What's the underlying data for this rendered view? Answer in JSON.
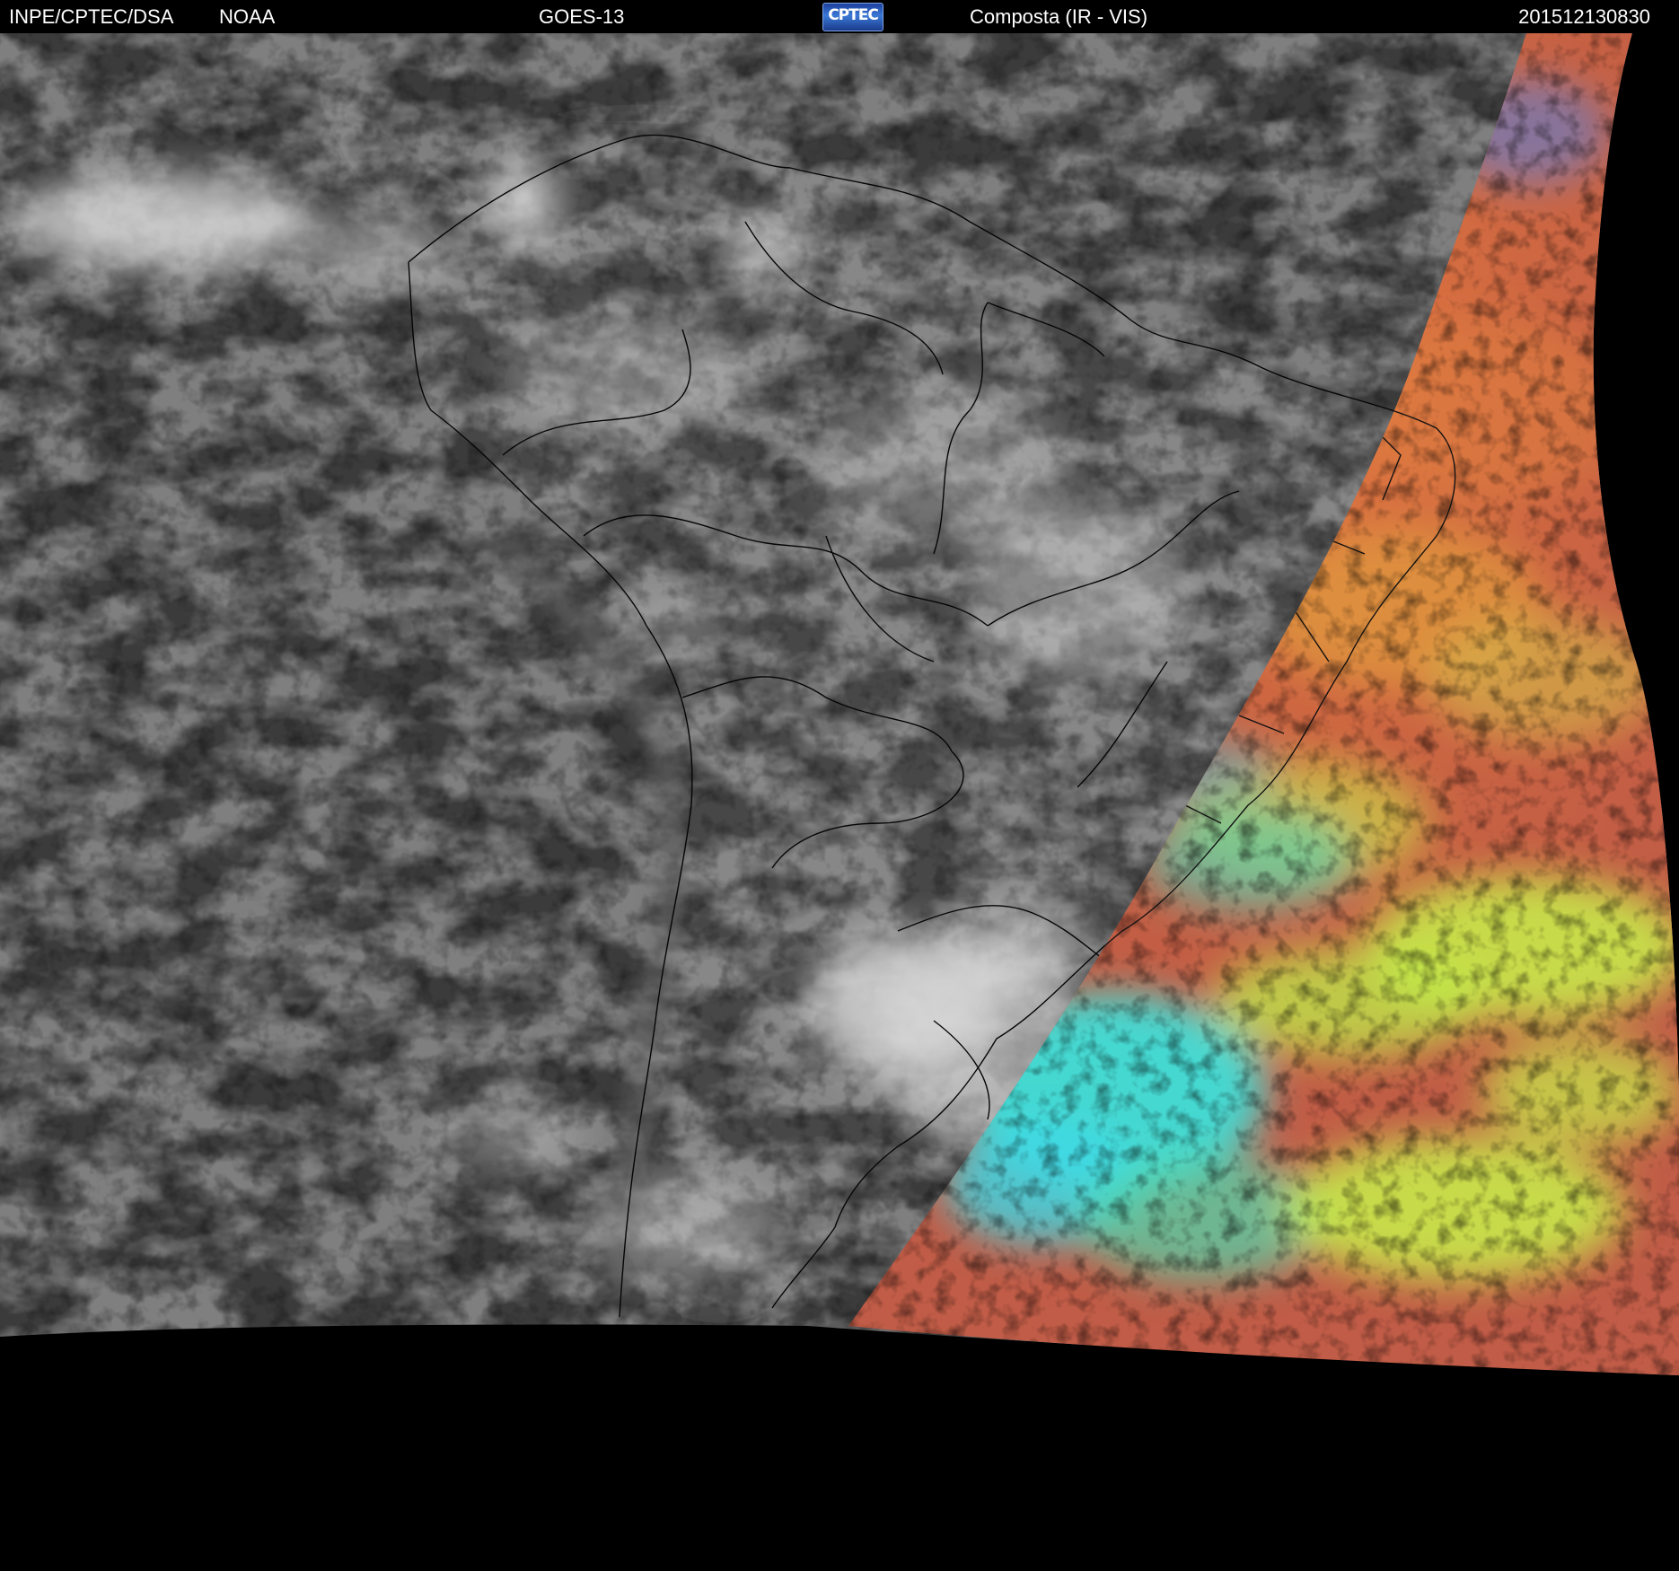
{
  "header": {
    "organization": "INPE/CPTEC/DSA",
    "agency": "NOAA",
    "satellite": "GOES-13",
    "logo_text": "CPTEC",
    "product": "Composta (IR - VIS)",
    "timestamp": "201512130830"
  },
  "imagery": {
    "colors": {
      "background": "#000000",
      "ir_ocean": "#3a3a3a",
      "ir_land": "#474747",
      "cloud": "#dcdcdc",
      "vis_red": "#c55f47",
      "vis_orange": "#e08a3c",
      "vis_yellowgreen": "#c8f04a",
      "vis_cyan": "#39e6e0",
      "vis_blue": "#5a7fd6",
      "border_lines": "#000000"
    }
  }
}
